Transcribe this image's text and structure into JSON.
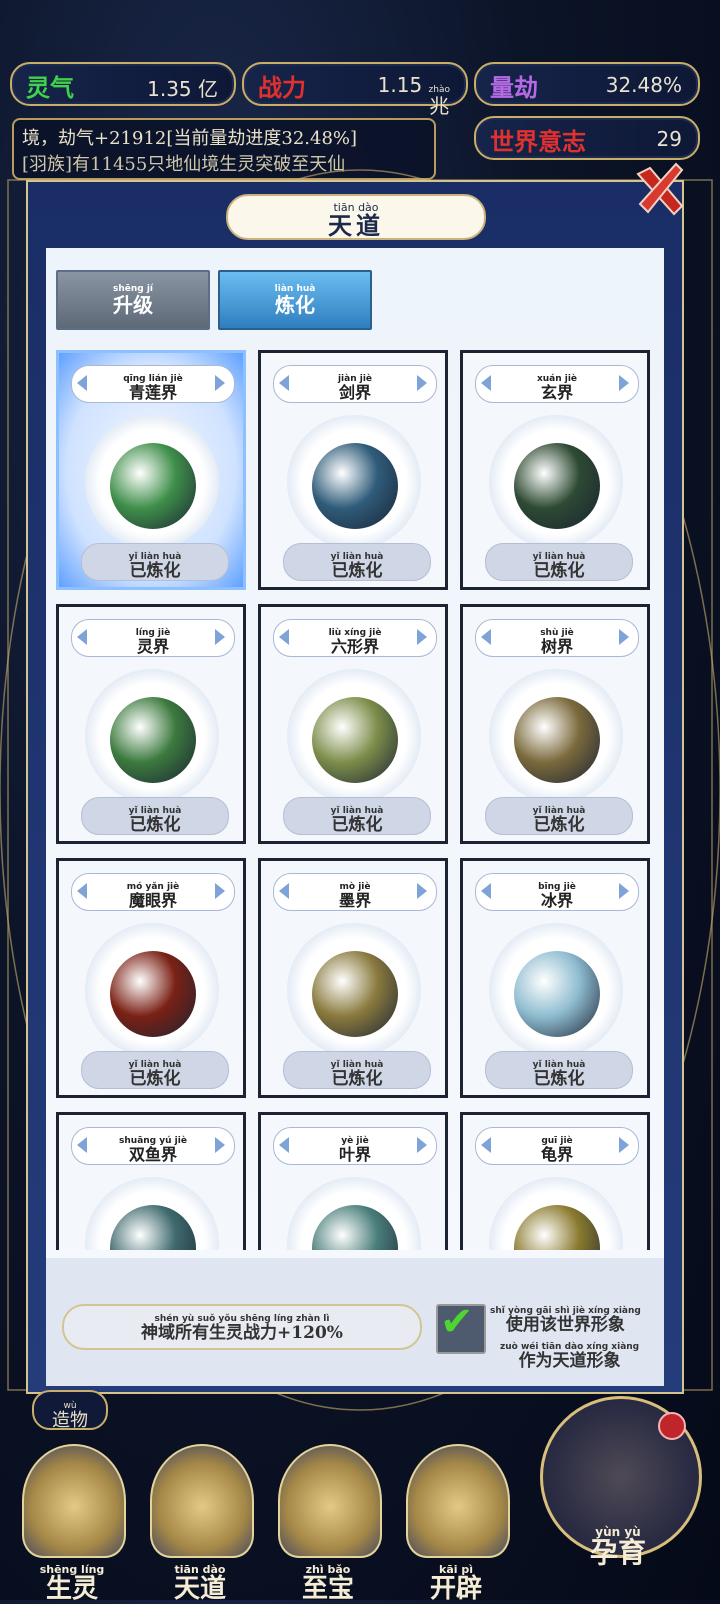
{
  "top_stats": [
    {
      "label": "灵气",
      "value": "1.35",
      "unit": "亿",
      "unit_py": "",
      "color": "#3fd24a"
    },
    {
      "label": "战力",
      "value": "1.15",
      "unit": "兆",
      "unit_py": "zhào",
      "color": "#e0312f"
    },
    {
      "label": "量劫",
      "value": "32.48%",
      "unit": "",
      "unit_py": "",
      "color": "#b76ae6"
    }
  ],
  "world_will": {
    "label": "世界意志",
    "value": "29"
  },
  "log_lines": [
    "境，劫气+21912[当前量劫进度32.48%]",
    "[羽族]有11455只地仙境生灵突破至天仙"
  ],
  "panel": {
    "title": "天道",
    "title_py": "tiān dào"
  },
  "tabs": [
    {
      "label": "升级",
      "py": "shēng jí",
      "active": false
    },
    {
      "label": "炼化",
      "py": "liàn huà",
      "active": true
    }
  ],
  "worlds": [
    {
      "name": "青莲界",
      "py": "qīng lián jiè",
      "status": "已炼化",
      "status_py": "yǐ liàn huà",
      "selected": true,
      "color": "#3f8f4a"
    },
    {
      "name": "剑界",
      "py": "jiàn jiè",
      "status": "已炼化",
      "status_py": "yǐ liàn huà",
      "selected": false,
      "color": "#2f5c7a"
    },
    {
      "name": "玄界",
      "py": "xuán jiè",
      "status": "已炼化",
      "status_py": "yǐ liàn huà",
      "selected": false,
      "color": "#2d4a33"
    },
    {
      "name": "灵界",
      "py": "líng jiè",
      "status": "已炼化",
      "status_py": "yǐ liàn huà",
      "selected": false,
      "color": "#3c7a3e"
    },
    {
      "name": "六形界",
      "py": "liù xíng jiè",
      "status": "已炼化",
      "status_py": "yǐ liàn huà",
      "selected": false,
      "color": "#7d8e4a"
    },
    {
      "name": "树界",
      "py": "shù jiè",
      "status": "已炼化",
      "status_py": "yǐ liàn huà",
      "selected": false,
      "color": "#7b6a3c"
    },
    {
      "name": "魔眼界",
      "py": "mó yǎn jiè",
      "status": "已炼化",
      "status_py": "yǐ liàn huà",
      "selected": false,
      "color": "#7a2115"
    },
    {
      "name": "墨界",
      "py": "mò jiè",
      "status": "已炼化",
      "status_py": "yǐ liàn huà",
      "selected": false,
      "color": "#8a7a3e"
    },
    {
      "name": "冰界",
      "py": "bīng jiè",
      "status": "已炼化",
      "status_py": "yǐ liàn huà",
      "selected": false,
      "color": "#8fbcd0"
    },
    {
      "name": "双鱼界",
      "py": "shuāng yú jiè",
      "status": "",
      "status_py": "",
      "selected": false,
      "color": "#3f6a6e"
    },
    {
      "name": "叶界",
      "py": "yè jiè",
      "status": "",
      "status_py": "",
      "selected": false,
      "color": "#4a7e7a"
    },
    {
      "name": "龟界",
      "py": "guī jiè",
      "status": "",
      "status_py": "",
      "selected": false,
      "color": "#8a7a2e"
    }
  ],
  "footer": {
    "bonus": "神域所有生灵战力+120%",
    "bonus_py": "shén yù suǒ yǒu shēng líng zhàn lì",
    "checkbox_line1": "使用该世界形象",
    "checkbox_line1_py": "shǐ yòng gāi shì jiè xíng xiàng",
    "checkbox_line2": "作为天道形象",
    "checkbox_line2_py": "zuò wéi tiān dào xíng xiàng",
    "checked": true
  },
  "side_button": {
    "label": "造物",
    "py": "wù"
  },
  "bottom_nav": [
    {
      "label": "生灵",
      "py": "shēng líng"
    },
    {
      "label": "天道",
      "py": "tiān dào"
    },
    {
      "label": "至宝",
      "py": "zhì bǎo"
    },
    {
      "label": "开辟",
      "py": "kāi pì"
    }
  ],
  "big_nav": {
    "label": "孕育",
    "py": "yùn yù"
  },
  "colors": {
    "gold": "#c9ae6a",
    "panel_blue": "#1a2d66",
    "tab_active": "#4fa0d8",
    "tab_inactive": "#6e7b8d"
  }
}
